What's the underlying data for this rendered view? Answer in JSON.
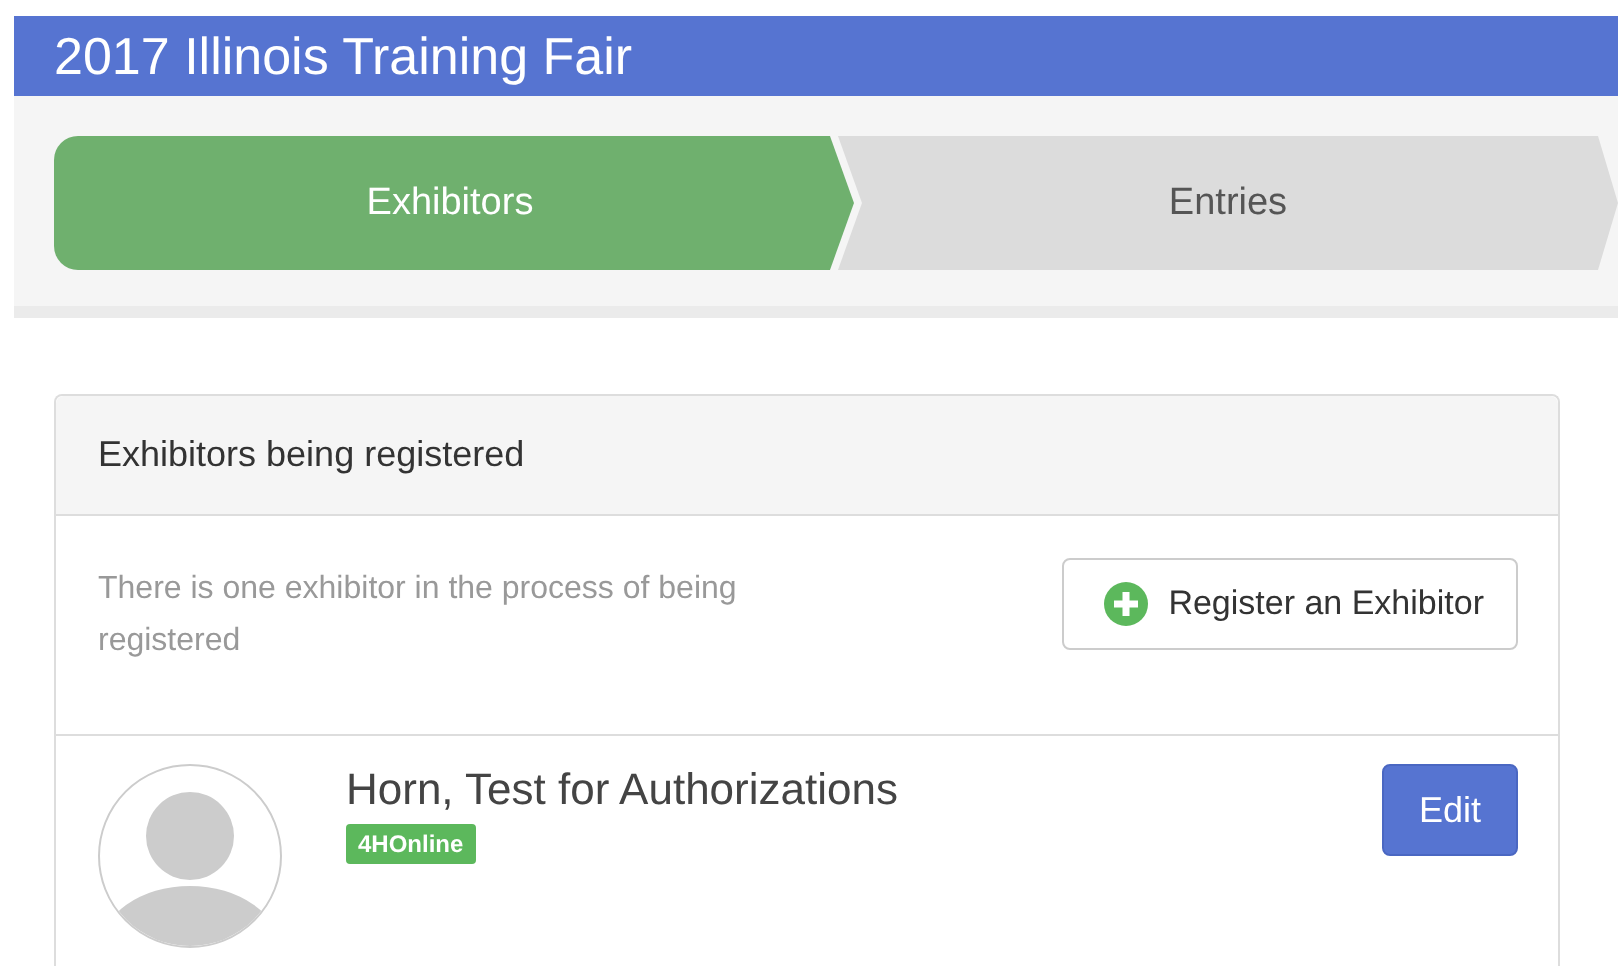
{
  "header": {
    "title": "2017 Illinois Training Fair"
  },
  "steps": [
    {
      "label": "Exhibitors",
      "selected": true
    },
    {
      "label": "Entries",
      "selected": false
    }
  ],
  "panel": {
    "title": "Exhibitors being registered",
    "message": "There is one exhibitor in the process of being registered",
    "register_button": "Register an Exhibitor",
    "exhibitors": [
      {
        "name": "Horn, Test for Authorizations",
        "badge": "4HOnline",
        "edit_button": "Edit"
      }
    ]
  }
}
